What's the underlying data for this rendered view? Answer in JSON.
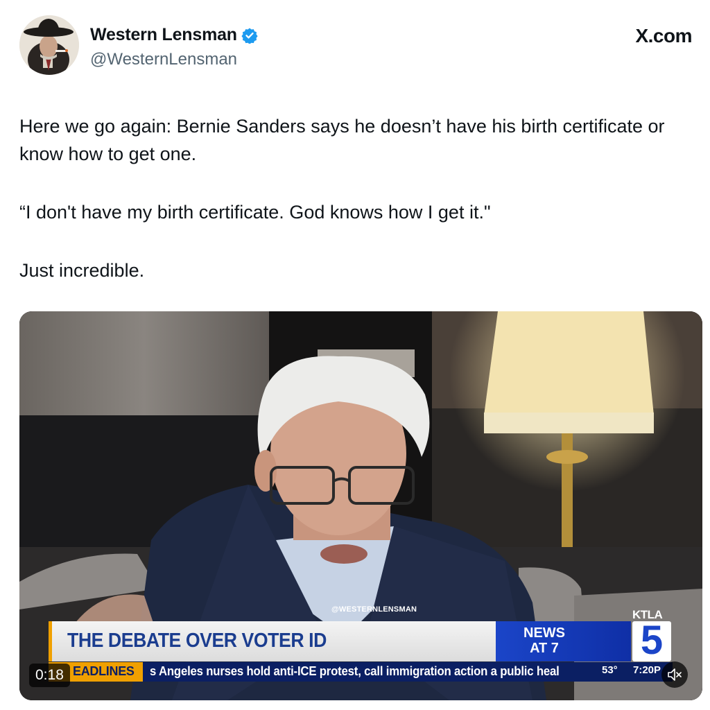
{
  "author": {
    "display_name": "Western Lensman",
    "handle": "@WesternLensman",
    "verified": true,
    "verified_color": "#1d9bf0",
    "avatar_icon": "avatar-cowboy-hat"
  },
  "site_mark": "X.com",
  "tweet": {
    "paragraphs": [
      "Here we go again: Bernie Sanders says he doesn’t have his birth certificate or know how to get one.",
      "“I don't have my birth certificate. God knows how I get it.\"",
      "Just incredible."
    ]
  },
  "video": {
    "watermark": "@WESTERNLENSMAN",
    "headline": "THE DEBATE OVER VOTER ID",
    "news_line1": "NEWS",
    "news_line2": "AT 7",
    "station": "KTLA",
    "channel_number": "5",
    "ticker_tag": "EADLINES",
    "ticker_text": "s Angeles nurses hold anti-ICE protest, call immigration action a public heal",
    "temperature": "53°",
    "clock": "7:20P",
    "timestamp": "0:18",
    "mute_icon": "speaker-muted-icon",
    "colors": {
      "headline_text": "#1b3d8f",
      "news_box": "#1b45c8",
      "ticker_bg": "#0b1f63",
      "ticker_tag": "#f0a000"
    }
  }
}
